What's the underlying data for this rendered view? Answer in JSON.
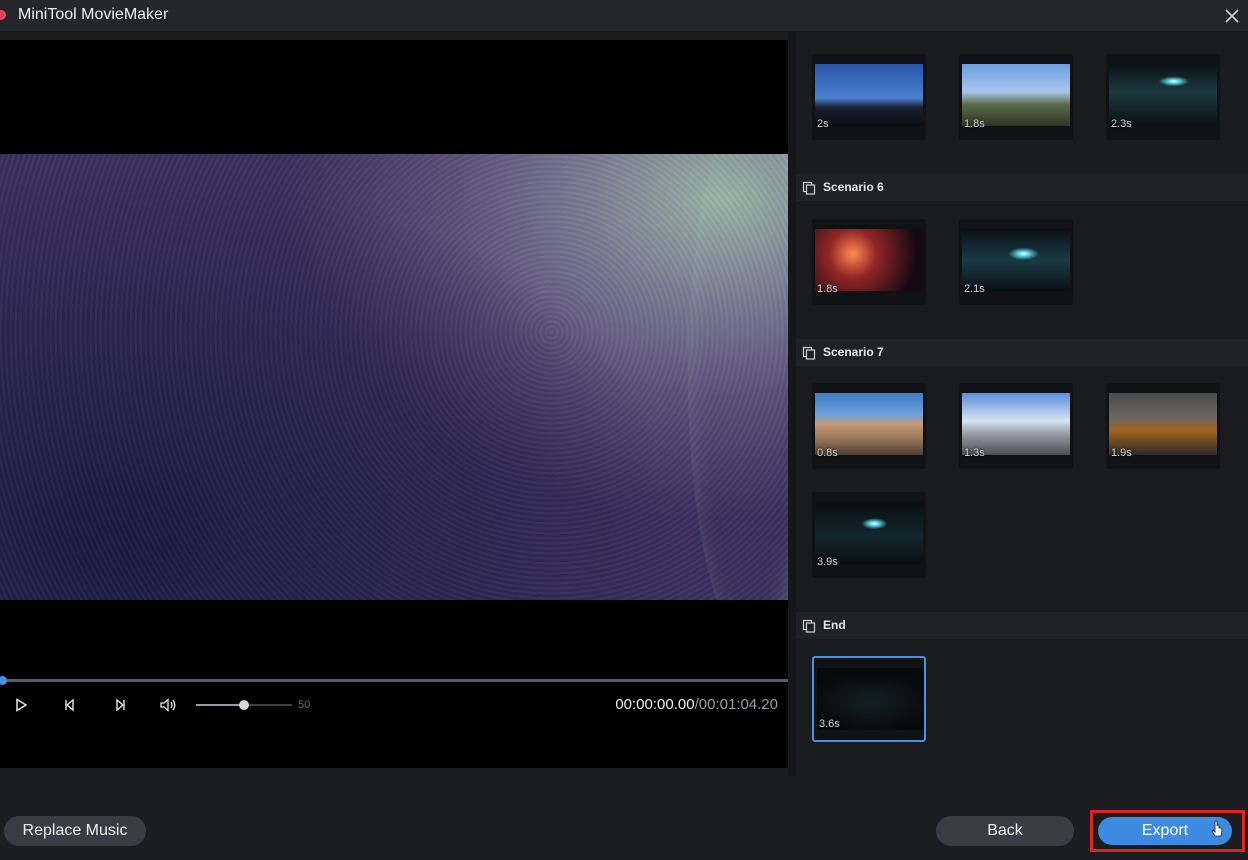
{
  "app": {
    "title": "MiniTool MovieMaker"
  },
  "player": {
    "progress": 0.0,
    "volume_value": "50",
    "volume_level": 0.5,
    "time_current": "00:00:00.00",
    "time_total": "/00:01:04.20"
  },
  "scenes": {
    "top_thumbs": [
      {
        "duration": "2s",
        "image": "night-mosque"
      },
      {
        "duration": "1.8s",
        "image": "day-mosque"
      },
      {
        "duration": "2.3s",
        "image": "light-streak"
      }
    ],
    "scenario6": {
      "label": "Scenario 6",
      "thumbs": [
        {
          "duration": "1.8s",
          "image": "concert"
        },
        {
          "duration": "2.1s",
          "image": "light-streak"
        }
      ]
    },
    "scenario7": {
      "label": "Scenario 7",
      "thumbs": [
        {
          "duration": "0.8s",
          "image": "ruins"
        },
        {
          "duration": "1.3s",
          "image": "mosque-courtyard"
        },
        {
          "duration": "1.9s",
          "image": "museum"
        },
        {
          "duration": "3.9s",
          "image": "light-streak"
        }
      ]
    },
    "end": {
      "label": "End",
      "thumbs": [
        {
          "duration": "3.6s",
          "image": "dark-end",
          "selected": true
        }
      ]
    }
  },
  "footer": {
    "replace_music": "Replace Music",
    "back": "Back",
    "export": "Export"
  },
  "colors": {
    "accent": "#3d8be0",
    "highlight": "#e0241f",
    "logo": "#e8435a"
  }
}
